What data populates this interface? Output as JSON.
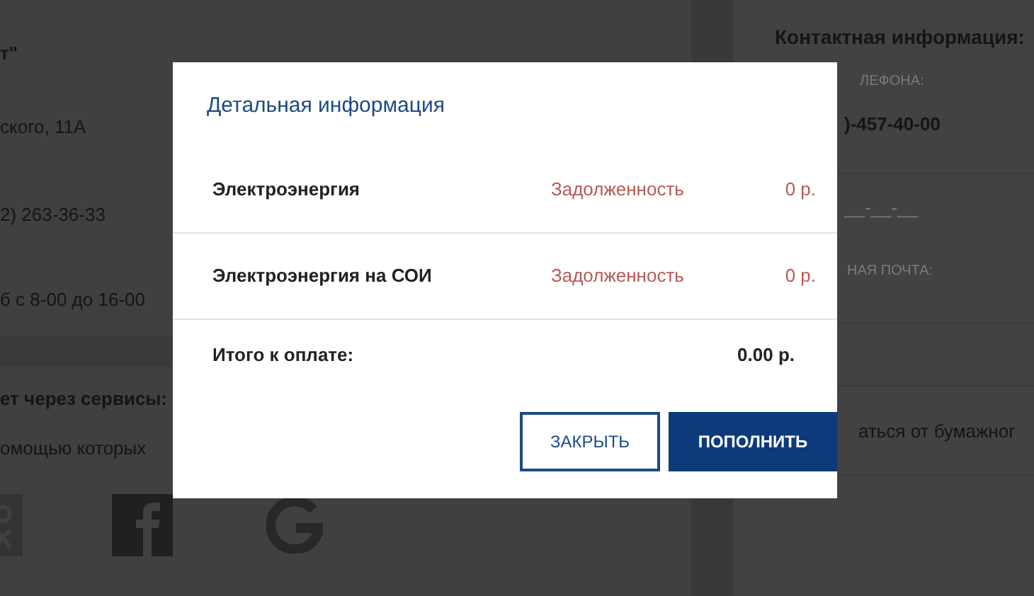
{
  "left_panel": {
    "org_name": "т\"",
    "address": "ского, 11А",
    "phone": "2) 263-36-33",
    "hours": "б с 8-00 до 16-00",
    "services_heading": "ет через сервисы:",
    "services_text": "омощью которых"
  },
  "right_panel": {
    "heading": "Контактная информация:",
    "phone_label": "ЛЕФОНА:",
    "phone": ")-457-40-00",
    "phone_extra": "__-__-__",
    "email_label": "НАЯ ПОЧТА:",
    "paper_option": "аться от бумажног"
  },
  "modal": {
    "title": "Детальная информация",
    "rows": [
      {
        "service": "Электроэнергия",
        "status": "Задолженность",
        "amount": "0 р."
      },
      {
        "service": "Электроэнергия на СОИ",
        "status": "Задолженность",
        "amount": "0 р."
      }
    ],
    "total_label": "Итого к оплате:",
    "total": "0.00 р.",
    "buttons": [
      {
        "label": "ЗАКРЫТЬ",
        "kind": "outline"
      },
      {
        "label": "ПОПОЛНИТЬ",
        "kind": "primary"
      }
    ]
  }
}
